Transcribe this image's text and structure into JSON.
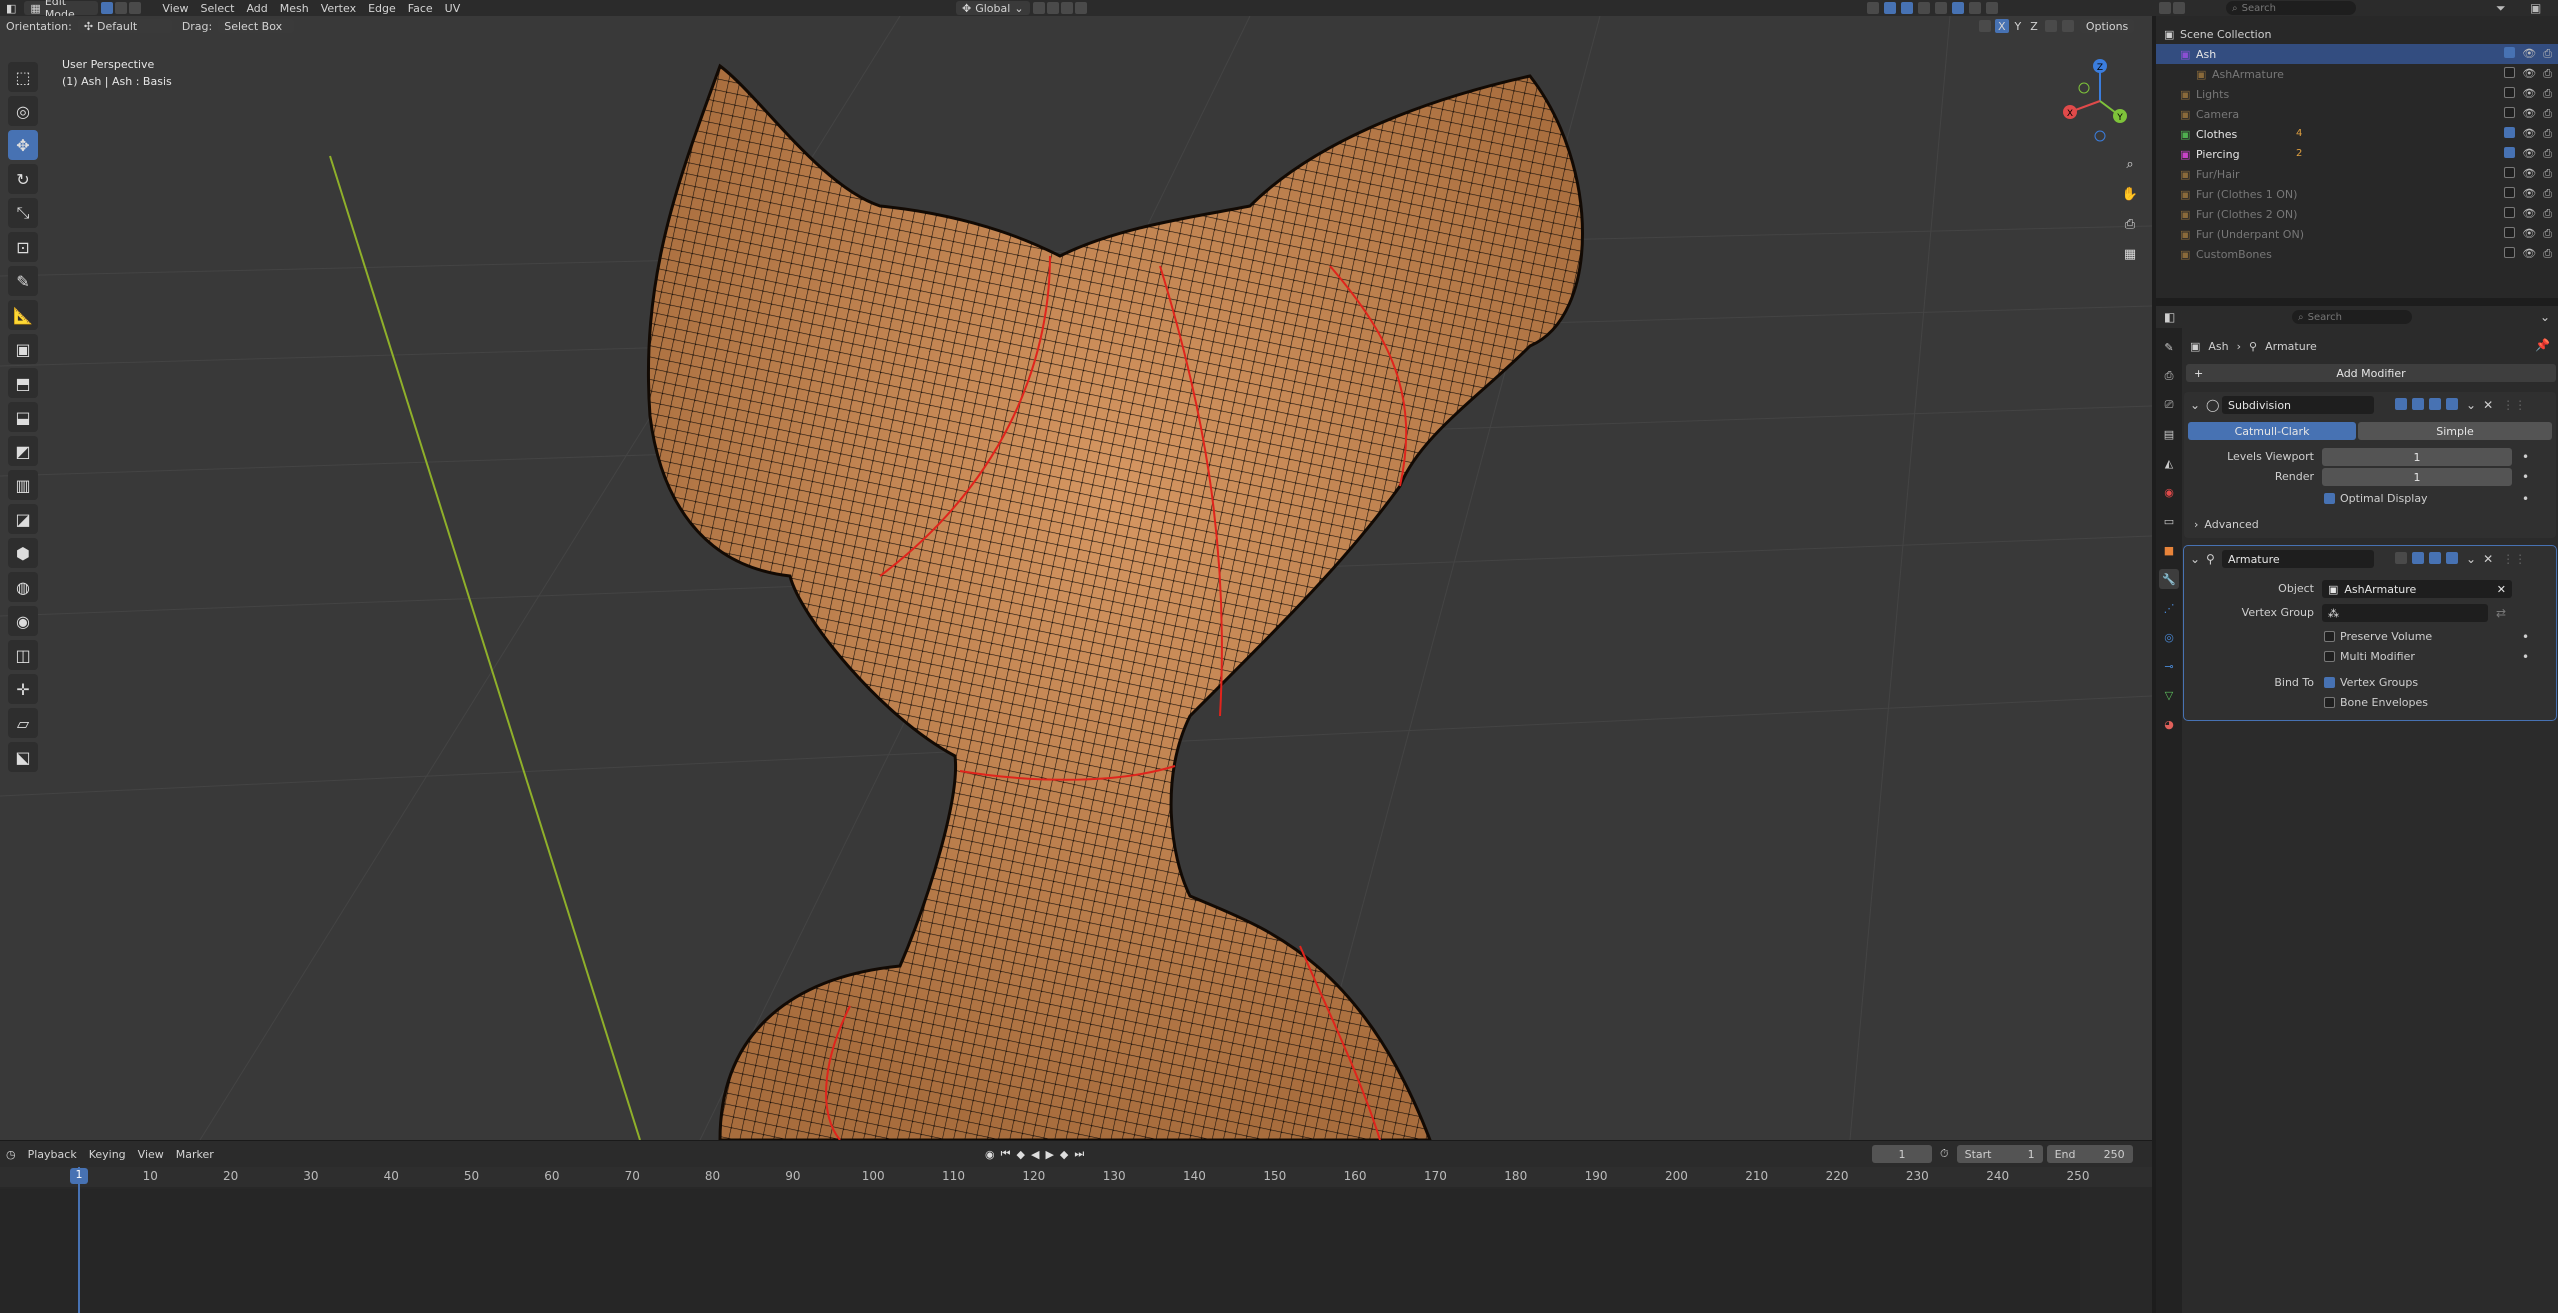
{
  "header": {
    "mode": "Edit Mode",
    "menus": [
      "View",
      "Select",
      "Add",
      "Mesh",
      "Vertex",
      "Edge",
      "Face",
      "UV"
    ],
    "transform_orientation": "Global",
    "search_placeholder": "Search"
  },
  "viewport": {
    "orientation_label": "Orientation:",
    "orientation_value": "Default",
    "drag_label": "Drag:",
    "drag_value": "Select Box",
    "axis_x": "X",
    "axis_y": "Y",
    "axis_z": "Z",
    "options_label": "Options",
    "perspective": "User Perspective",
    "object_info": "(1) Ash | Ash : Basis",
    "gizmo": {
      "x": "X",
      "y": "Y",
      "z": "Z"
    },
    "colors": {
      "mesh": "#c98a52",
      "seam": "#e0241c",
      "grid_y_axis": "#8fb02a"
    }
  },
  "timeline": {
    "menus": [
      "Playback",
      "Keying",
      "View",
      "Marker"
    ],
    "current_frame": "1",
    "start_label": "Start",
    "start_value": "1",
    "end_label": "End",
    "end_value": "250",
    "ticks": [
      "1",
      "10",
      "20",
      "30",
      "40",
      "50",
      "60",
      "70",
      "80",
      "90",
      "100",
      "110",
      "120",
      "130",
      "140",
      "150",
      "160",
      "170",
      "180",
      "190",
      "200",
      "210",
      "220",
      "230",
      "240",
      "250"
    ]
  },
  "outliner": {
    "search_placeholder": "Search",
    "root": "Scene Collection",
    "items": [
      {
        "name": "Ash",
        "color": "#8b4fd2",
        "dim": false
      },
      {
        "name": "AshArmature",
        "color": "#8a6a3a",
        "dim": true
      },
      {
        "name": "Lights",
        "color": "#8a6a3a",
        "dim": true
      },
      {
        "name": "Camera",
        "color": "#8a6a3a",
        "dim": true
      },
      {
        "name": "Clothes",
        "color": "#4fb04f",
        "dim": false
      },
      {
        "name": "Piercing",
        "color": "#c843c8",
        "dim": false
      },
      {
        "name": "Fur/Hair",
        "color": "#8a6a3a",
        "dim": true
      },
      {
        "name": "Fur (Clothes 1 ON)",
        "color": "#8a6a3a",
        "dim": true
      },
      {
        "name": "Fur (Clothes 2 ON)",
        "color": "#8a6a3a",
        "dim": true
      },
      {
        "name": "Fur (Underpant ON)",
        "color": "#8a6a3a",
        "dim": true
      },
      {
        "name": "CustomBones",
        "color": "#8a6a3a",
        "dim": true
      }
    ],
    "counts": {
      "clothes": "4",
      "piercing": "2"
    }
  },
  "properties": {
    "search_placeholder": "Search",
    "breadcrumb_object": "Ash",
    "breadcrumb_modifier": "Armature",
    "add_modifier": "Add Modifier",
    "subdivision": {
      "name": "Subdivision",
      "type_catmull": "Catmull-Clark",
      "type_simple": "Simple",
      "levels_viewport_label": "Levels Viewport",
      "levels_viewport_value": "1",
      "render_label": "Render",
      "render_value": "1",
      "optimal_display": "Optimal Display",
      "advanced": "Advanced"
    },
    "armature": {
      "name": "Armature",
      "object_label": "Object",
      "object_value": "AshArmature",
      "vertex_group_label": "Vertex Group",
      "preserve_volume": "Preserve Volume",
      "multi_modifier": "Multi Modifier",
      "bind_to_label": "Bind To",
      "vertex_groups": "Vertex Groups",
      "bone_envelopes": "Bone Envelopes"
    },
    "accent": "#4772b3"
  }
}
